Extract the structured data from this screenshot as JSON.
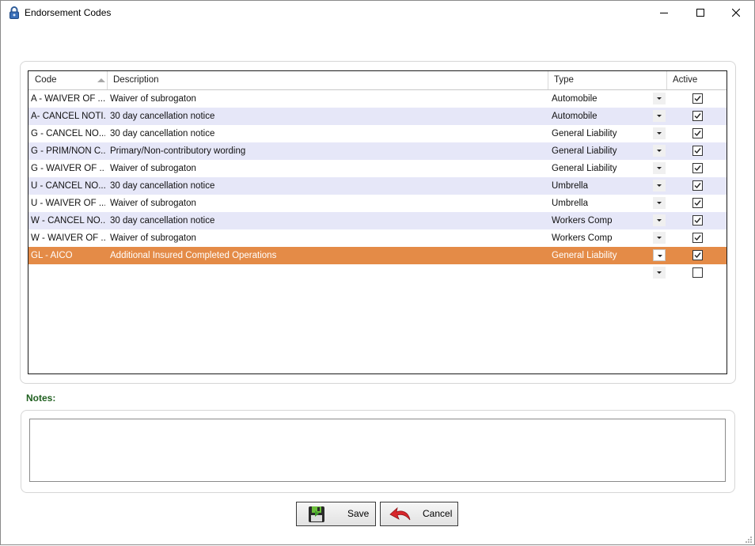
{
  "window": {
    "title": "Endorsement Codes",
    "icon": "padlock-icon",
    "controls": [
      "minimize-icon",
      "maximize-icon",
      "close-icon"
    ]
  },
  "grid": {
    "columns": {
      "code": "Code",
      "description": "Description",
      "type": "Type",
      "active": "Active"
    },
    "sort": {
      "column": "Code",
      "direction": "ascending"
    },
    "rows": [
      {
        "code": "A - WAIVER OF ...",
        "description": "Waiver of subrogaton",
        "type": "Automobile",
        "active": true,
        "selected": false
      },
      {
        "code": "A- CANCEL NOTI...",
        "description": "30 day cancellation notice",
        "type": "Automobile",
        "active": true,
        "selected": false
      },
      {
        "code": "G - CANCEL NO...",
        "description": "30 day cancellation notice",
        "type": "General Liability",
        "active": true,
        "selected": false
      },
      {
        "code": "G - PRIM/NON C...",
        "description": "Primary/Non-contributory wording",
        "type": "General Liability",
        "active": true,
        "selected": false
      },
      {
        "code": "G - WAIVER OF ...",
        "description": "Waiver of subrogaton",
        "type": "General Liability",
        "active": true,
        "selected": false
      },
      {
        "code": "U - CANCEL NO...",
        "description": "30 day cancellation notice",
        "type": "Umbrella",
        "active": true,
        "selected": false
      },
      {
        "code": "U - WAIVER OF ...",
        "description": "Waiver of subrogaton",
        "type": "Umbrella",
        "active": true,
        "selected": false
      },
      {
        "code": "W - CANCEL NO...",
        "description": "30 day cancellation notice",
        "type": "Workers Comp",
        "active": true,
        "selected": false
      },
      {
        "code": "W - WAIVER OF ...",
        "description": "Waiver of subrogaton",
        "type": "Workers Comp",
        "active": true,
        "selected": false
      },
      {
        "code": "GL - AICO",
        "description": "Additional Insured Completed Operations",
        "type": "General Liability",
        "active": true,
        "selected": true
      },
      {
        "code": "",
        "description": "",
        "type": "",
        "active": false,
        "selected": false
      }
    ]
  },
  "notes": {
    "label": "Notes:",
    "value": ""
  },
  "buttons": {
    "save": {
      "label": "Save",
      "icon": "floppy-disk-icon"
    },
    "cancel": {
      "label": "Cancel",
      "icon": "undo-arrow-icon"
    }
  },
  "colors": {
    "selected_row": "#e48b47",
    "alt_row": "#e6e7f8",
    "notes_label": "#1f5f1f"
  }
}
